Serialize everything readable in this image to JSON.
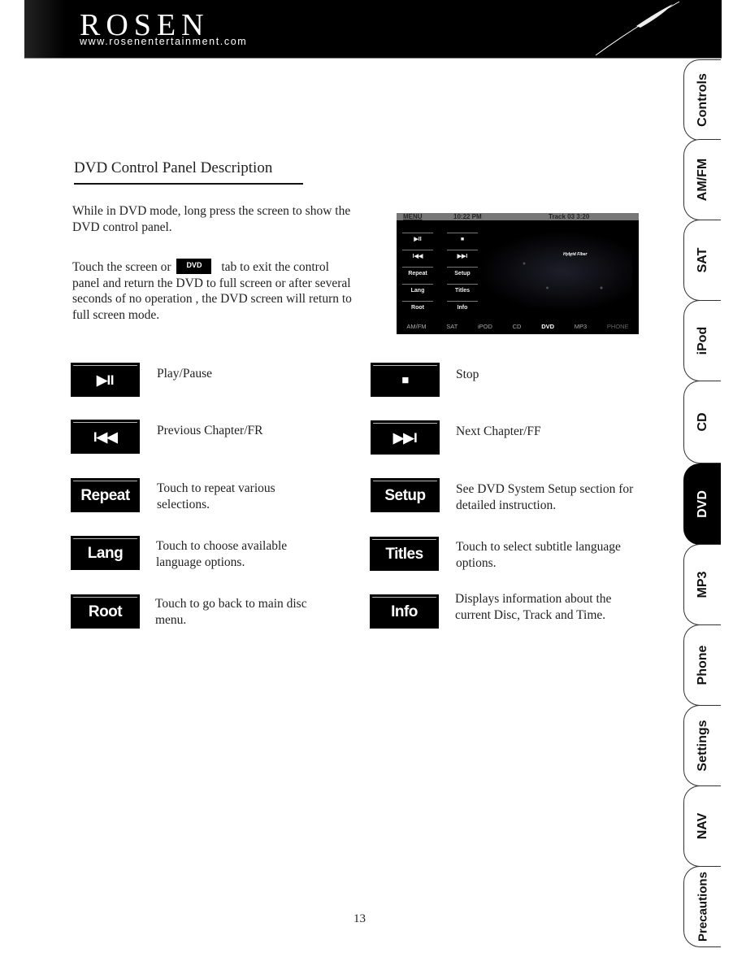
{
  "header": {
    "brand": "ROSEN",
    "url": "www.rosenentertainment.com"
  },
  "section": {
    "title": "DVD Control Panel Description",
    "paragraph1": "While in DVD mode, long press the screen to show the DVD control panel.",
    "paragraph2_before": "Touch the screen or",
    "paragraph2_badge": "DVD",
    "paragraph2_after": "tab to exit the control panel and return the DVD to full screen or after several seconds of no operation , the DVD screen will return to full screen mode."
  },
  "screen": {
    "menu": "MENU",
    "clock": "10:22 PM",
    "track": "Track 03 3:20",
    "caption": "Hybrid Fiber",
    "buttons": [
      "▶II",
      "■",
      "I◀◀",
      "▶▶I",
      "Repeat",
      "Setup",
      "Lang",
      "Titles",
      "Root",
      "Info"
    ],
    "nav": [
      {
        "label": "AM/FM",
        "state": "normal"
      },
      {
        "label": "SAT",
        "state": "normal"
      },
      {
        "label": "iPOD",
        "state": "normal"
      },
      {
        "label": "CD",
        "state": "normal"
      },
      {
        "label": "DVD",
        "state": "active"
      },
      {
        "label": "MP3",
        "state": "normal"
      },
      {
        "label": "PHONE",
        "state": "dim"
      }
    ]
  },
  "controls": [
    {
      "button": "▶II",
      "icon": "play-pause-icon",
      "description": "Play/Pause"
    },
    {
      "button": "■",
      "icon": "stop-icon",
      "description": "Stop"
    },
    {
      "button": "I◀◀",
      "icon": "previous-chapter-icon",
      "description": "Previous Chapter/FR"
    },
    {
      "button": "▶▶I",
      "icon": "next-chapter-icon",
      "description": "Next Chapter/FF"
    },
    {
      "button": "Repeat",
      "description": "Touch to repeat various selections."
    },
    {
      "button": "Setup",
      "description": "See DVD System Setup section for detailed instruction."
    },
    {
      "button": "Lang",
      "description": "Touch to choose available language options."
    },
    {
      "button": "Titles",
      "description": "Touch to select subtitle language options."
    },
    {
      "button": "Root",
      "description": "Touch to go back to main disc menu."
    },
    {
      "button": "Info",
      "description": "Displays information about the current Disc, Track and Time."
    }
  ],
  "side_tabs": [
    {
      "label": "Controls",
      "active": false
    },
    {
      "label": "AM/FM",
      "active": false
    },
    {
      "label": "SAT",
      "active": false
    },
    {
      "label": "iPod",
      "active": false
    },
    {
      "label": "CD",
      "active": false
    },
    {
      "label": "DVD",
      "active": true
    },
    {
      "label": "MP3",
      "active": false
    },
    {
      "label": "Phone",
      "active": false
    },
    {
      "label": "Settings",
      "active": false
    },
    {
      "label": "NAV",
      "active": false
    },
    {
      "label": "Precautions",
      "active": false
    }
  ],
  "page_number": "13"
}
